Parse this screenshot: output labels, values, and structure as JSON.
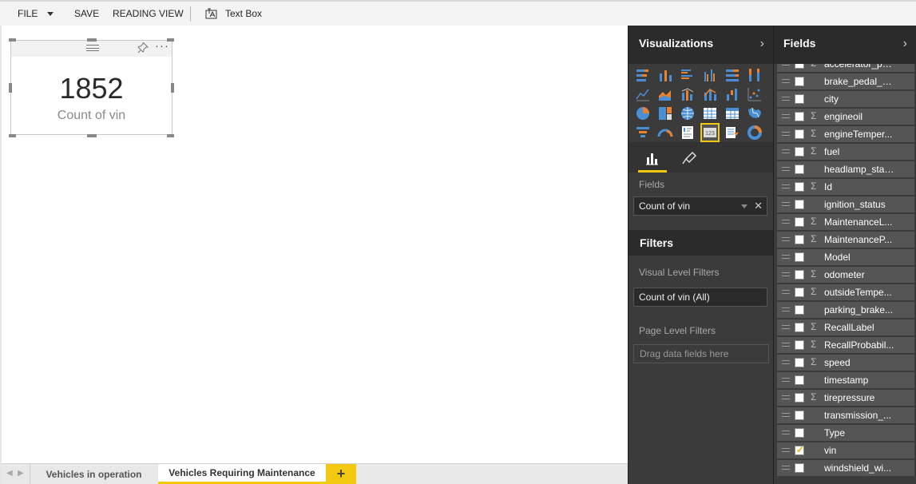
{
  "toolbar": {
    "file_label": "FILE",
    "save_label": "SAVE",
    "reading_view_label": "READING VIEW",
    "text_box_label": "Text Box"
  },
  "card": {
    "value": "1852",
    "label": "Count of vin"
  },
  "tabs": {
    "items": [
      {
        "label": "Vehicles in operation"
      },
      {
        "label": "Vehicles Requiring Maintenance"
      }
    ],
    "add_label": "+"
  },
  "visualizations": {
    "title": "Visualizations",
    "fields_label": "Fields",
    "fields_value": "Count of vin",
    "filters_title": "Filters",
    "visual_level_filters_label": "Visual Level Filters",
    "visual_level_filter_value": "Count of vin (All)",
    "page_level_filters_label": "Page Level Filters",
    "drag_placeholder": "Drag data fields here"
  },
  "fields": {
    "title": "Fields",
    "items": [
      {
        "name": "accelerator_pe...",
        "sigma": true,
        "checked": false
      },
      {
        "name": "brake_pedal_s...",
        "sigma": false,
        "checked": false
      },
      {
        "name": "city",
        "sigma": false,
        "checked": false
      },
      {
        "name": "engineoil",
        "sigma": true,
        "checked": false
      },
      {
        "name": "engineTemper...",
        "sigma": true,
        "checked": false
      },
      {
        "name": "fuel",
        "sigma": true,
        "checked": false
      },
      {
        "name": "headlamp_stat...",
        "sigma": false,
        "checked": false
      },
      {
        "name": "Id",
        "sigma": true,
        "checked": false
      },
      {
        "name": "ignition_status",
        "sigma": false,
        "checked": false
      },
      {
        "name": "MaintenanceL...",
        "sigma": true,
        "checked": false
      },
      {
        "name": "MaintenanceP...",
        "sigma": true,
        "checked": false
      },
      {
        "name": "Model",
        "sigma": false,
        "checked": false
      },
      {
        "name": "odometer",
        "sigma": true,
        "checked": false
      },
      {
        "name": "outsideTempe...",
        "sigma": true,
        "checked": false
      },
      {
        "name": "parking_brake...",
        "sigma": false,
        "checked": false
      },
      {
        "name": "RecallLabel",
        "sigma": true,
        "checked": false
      },
      {
        "name": "RecallProbabil...",
        "sigma": true,
        "checked": false
      },
      {
        "name": "speed",
        "sigma": true,
        "checked": false
      },
      {
        "name": "timestamp",
        "sigma": false,
        "checked": false
      },
      {
        "name": "tirepressure",
        "sigma": true,
        "checked": false
      },
      {
        "name": "transmission_...",
        "sigma": false,
        "checked": false
      },
      {
        "name": "Type",
        "sigma": false,
        "checked": false
      },
      {
        "name": "vin",
        "sigma": false,
        "checked": true
      },
      {
        "name": "windshield_wi...",
        "sigma": false,
        "checked": false
      }
    ]
  },
  "colors": {
    "accent": "#f2c811",
    "pane_dark": "#2b2b2b",
    "pane_mid": "#3b3b3b",
    "icon_blue": "#4a8fd6",
    "icon_orange": "#e8822e"
  }
}
